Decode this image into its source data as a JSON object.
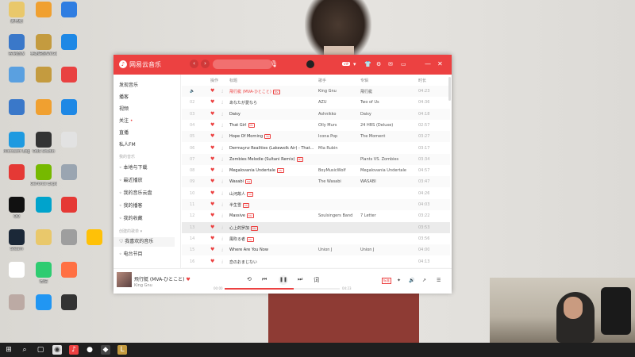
{
  "desktop": {
    "icons": [
      {
        "label": "此电脑",
        "color": "#e9c86b"
      },
      {
        "label": "",
        "color": "#f0a030"
      },
      {
        "label": "",
        "color": "#2f7de1"
      },
      {
        "label": "控制面板",
        "color": "#3a78c9"
      },
      {
        "label": "英雄联盟WeGame版",
        "color": "#c49b3f"
      },
      {
        "label": "",
        "color": "#1e88e5"
      },
      {
        "label": "",
        "color": "#5aa0e0"
      },
      {
        "label": "",
        "color": "#c49b3f"
      },
      {
        "label": "",
        "color": "#e94141"
      },
      {
        "label": "",
        "color": "#3a78c9"
      },
      {
        "label": "",
        "color": "#f0a030"
      },
      {
        "label": "",
        "color": "#1e88e5"
      },
      {
        "label": "Microsoft Edge",
        "color": "#1e9ae0"
      },
      {
        "label": "OBS Studio",
        "color": "#333333"
      },
      {
        "label": "",
        "color": "#e2e2e2"
      },
      {
        "label": "",
        "color": "#e53935"
      },
      {
        "label": "GeForce Experience",
        "color": "#76b900"
      },
      {
        "label": "",
        "color": "#9aa5b1"
      },
      {
        "label": "QQ",
        "color": "#111111"
      },
      {
        "label": "",
        "color": "#00a3cc"
      },
      {
        "label": "",
        "color": "#e53935"
      },
      {
        "label": "Steam",
        "color": "#1b2838"
      },
      {
        "label": "",
        "color": "#e9c86b"
      },
      {
        "label": "",
        "color": "#9e9e9e"
      },
      {
        "label": "",
        "color": "#ffffff"
      },
      {
        "label": "微信",
        "color": "#2ecc71"
      },
      {
        "label": "",
        "color": "#ff7043"
      },
      {
        "label": "",
        "color": "#bcaaa4"
      },
      {
        "label": "",
        "color": "#2196f3"
      },
      {
        "label": "",
        "color": "#333333"
      },
      {
        "label": "",
        "color": "#ffc107"
      }
    ]
  },
  "app": {
    "title": "网易云音乐",
    "search_placeholder": "",
    "username": "",
    "vip": "VIP",
    "accent": "#ec4141",
    "sidebar": {
      "items": [
        "发现音乐",
        "播客",
        "视频",
        "关注",
        "直播",
        "私人FM"
      ],
      "section_mine": "我的音乐",
      "mine_items": [
        "本地与下载",
        "最近播放",
        "我的音乐云盘",
        "我的播客",
        "我的收藏"
      ],
      "section_created": "创建的歌单",
      "created_items": [
        "我喜欢的音乐",
        "电台节目"
      ]
    },
    "columns": {
      "action": "操作",
      "title": "标题",
      "artist": "歌手",
      "album": "专辑",
      "duration": "时长"
    },
    "tracks": [
      {
        "num": "01",
        "title": "飛行艇 (MVA-ひとこと)",
        "artist": "King Gnu",
        "album": "飛行艇",
        "duration": "04:23",
        "tag": "MV",
        "playing": true
      },
      {
        "num": "02",
        "title": "あなたが愛なら",
        "artist": "AZU",
        "album": "Two of Us",
        "duration": "04:36",
        "tag": ""
      },
      {
        "num": "03",
        "title": "Daisy",
        "artist": "Ashnikko",
        "album": "Daisy",
        "duration": "04:18",
        "tag": ""
      },
      {
        "num": "04",
        "title": "That Girl",
        "artist": "Olly Murs",
        "album": "24 HRS (Deluxe)",
        "duration": "02:57",
        "tag": "MV"
      },
      {
        "num": "05",
        "title": "Hope Of Morning",
        "artist": "Icona Pop",
        "album": "The Moment",
        "duration": "03:27",
        "tag": "SQ"
      },
      {
        "num": "06",
        "title": "Dermaynz Realities (Lakewolk Air) - That...",
        "artist": "Mia Rubin",
        "album": "",
        "duration": "03:17",
        "tag": ""
      },
      {
        "num": "07",
        "title": "Zombies Melodie (Sultani Remix)",
        "artist": "",
        "album": "Plants VS. Zombies",
        "duration": "03:34",
        "tag": "MV"
      },
      {
        "num": "08",
        "title": "Megalovania Undertale",
        "artist": "BoyMusicWolf",
        "album": "Megalovania Undertale",
        "duration": "04:57",
        "tag": "MV"
      },
      {
        "num": "09",
        "title": "Wasabi",
        "artist": "The Wasabi",
        "album": "WASABI",
        "duration": "03:47",
        "tag": "SQ"
      },
      {
        "num": "10",
        "title": "山河故人",
        "artist": "",
        "album": "",
        "duration": "04:26",
        "tag": "SQ"
      },
      {
        "num": "11",
        "title": "半生雪",
        "artist": "",
        "album": "",
        "duration": "04:03",
        "tag": "SQ"
      },
      {
        "num": "12",
        "title": "Massive",
        "artist": "Soulsingers Band",
        "album": "7 Letter",
        "duration": "03:22",
        "tag": "MV"
      },
      {
        "num": "13",
        "title": "心上的罗加",
        "artist": "",
        "album": "",
        "duration": "03:53",
        "tag": "MV",
        "selected": true
      },
      {
        "num": "14",
        "title": "風吹る者",
        "artist": "",
        "album": "",
        "duration": "03:56",
        "tag": "MV"
      },
      {
        "num": "15",
        "title": "Where Are You Now",
        "artist": "Union J",
        "album": "Union J",
        "duration": "04:00",
        "tag": ""
      },
      {
        "num": "16",
        "title": "恋のおまじない",
        "artist": "",
        "album": "",
        "duration": "04:13",
        "tag": ""
      },
      {
        "num": "17",
        "title": "",
        "artist": "",
        "album": "",
        "duration": "",
        "tag": ""
      }
    ],
    "player": {
      "title": "飛行艇 (MVA-ひとこと)",
      "artist": "King Gnu",
      "time_current": "00:00",
      "time_total": "04:23",
      "progress": 0.6,
      "quality": "标准"
    }
  }
}
